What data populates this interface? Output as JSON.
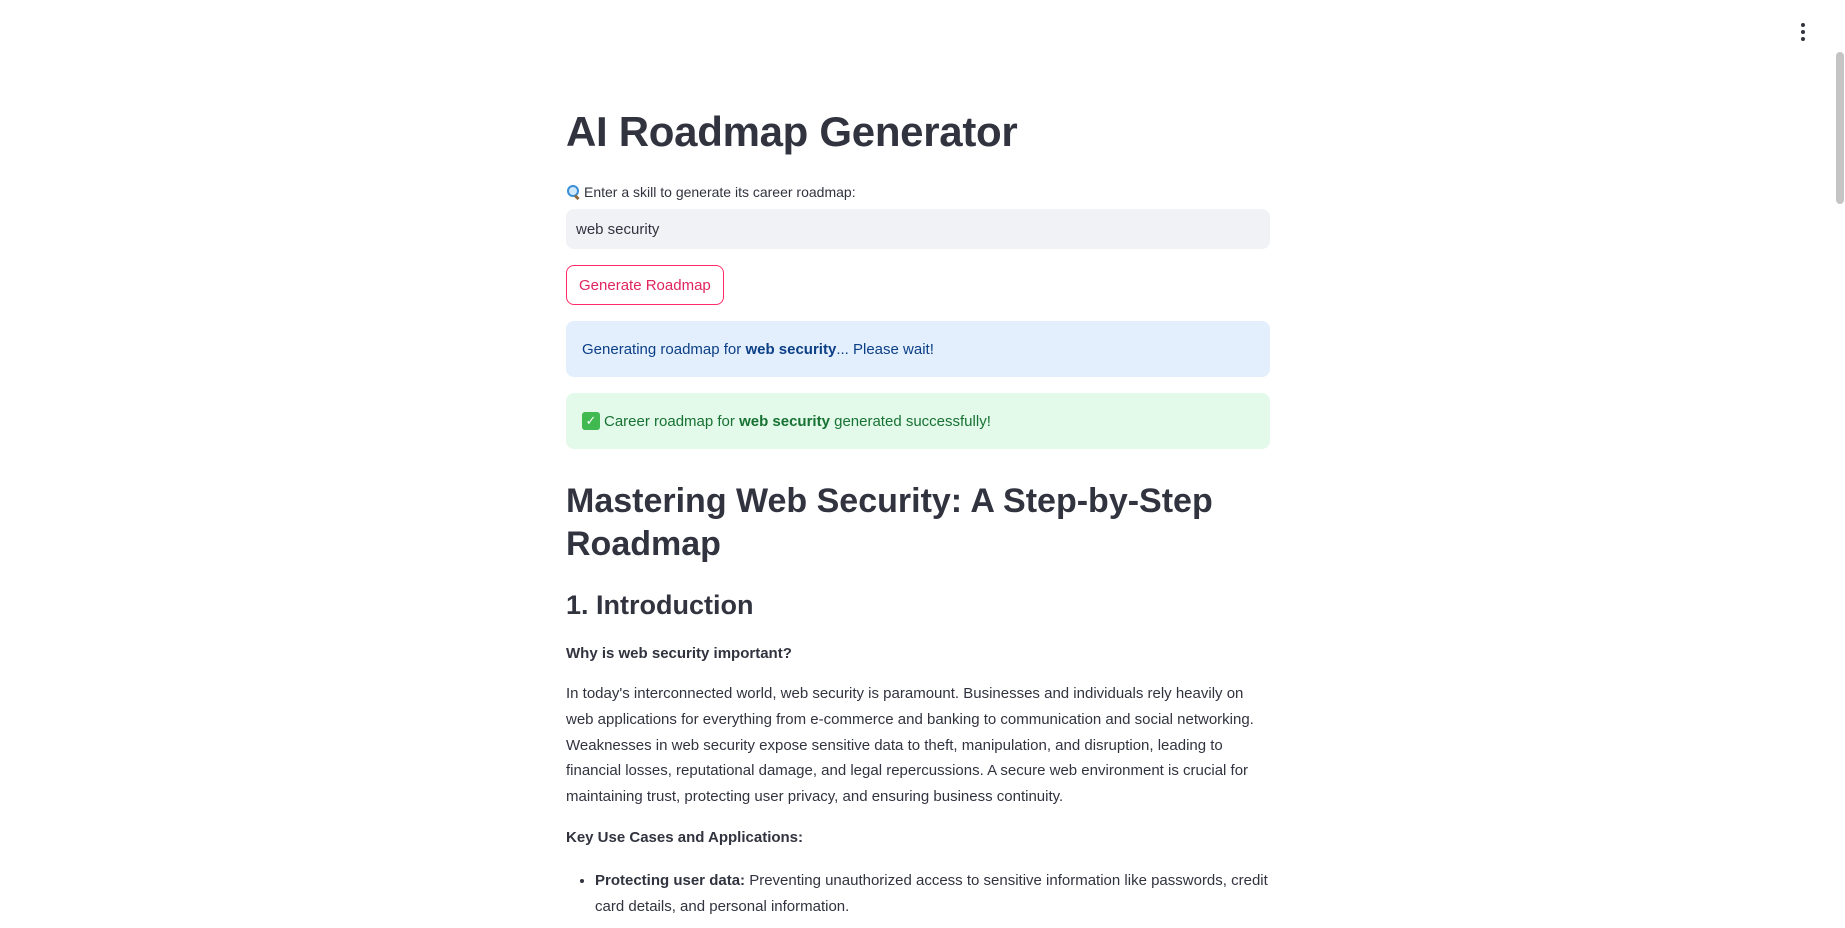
{
  "header": {
    "menu_icon": "vertical-ellipsis-icon"
  },
  "main": {
    "title": "AI Roadmap Generator",
    "input_label": "Enter a skill to generate its career roadmap:",
    "input_label_icon": "magnifying-glass-icon",
    "input_value": "web security",
    "generate_button_label": "Generate Roadmap",
    "info_alert": {
      "prefix": "Generating roadmap for ",
      "skill": "web security",
      "suffix": "... Please wait!"
    },
    "success_alert": {
      "icon": "check-mark-button-icon",
      "prefix": "Career roadmap for ",
      "skill": "web security",
      "suffix": " generated successfully!"
    }
  },
  "roadmap": {
    "title": "Mastering Web Security: A Step-by-Step Roadmap",
    "section_title": "1. Introduction",
    "why_heading": "Why is web security important?",
    "intro_paragraph": "In today's interconnected world, web security is paramount. Businesses and individuals rely heavily on web applications for everything from e-commerce and banking to communication and social networking. Weaknesses in web security expose sensitive data to theft, manipulation, and disruption, leading to financial losses, reputational damage, and legal repercussions. A secure web environment is crucial for maintaining trust, protecting user privacy, and ensuring business continuity.",
    "use_cases_heading": "Key Use Cases and Applications:",
    "use_cases": [
      {
        "label": "Protecting user data:",
        "text": " Preventing unauthorized access to sensitive information like passwords, credit card details, and personal information."
      }
    ]
  },
  "colors": {
    "accent": "#ff2b67",
    "info_background": "#e3effd",
    "info_text": "#0c3f86",
    "success_background": "#e3f9ea",
    "success_text": "#177233",
    "input_background": "#f0f2f6",
    "text": "#31333f"
  }
}
